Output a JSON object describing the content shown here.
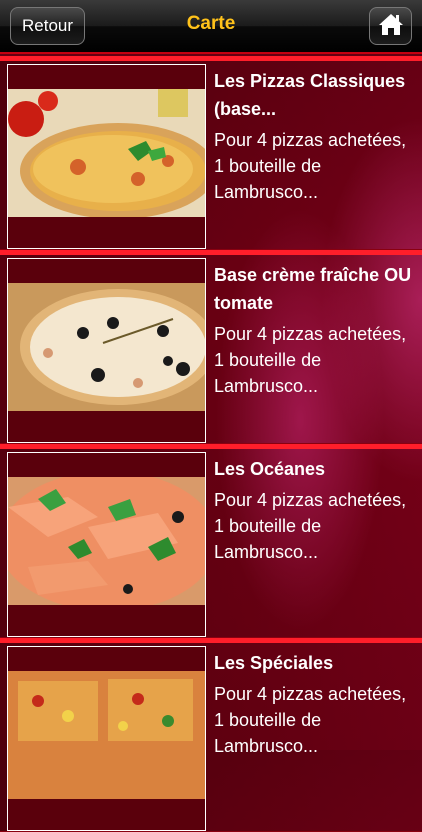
{
  "navbar": {
    "back_label": "Retour",
    "title": "Carte",
    "home_icon": "home-icon"
  },
  "items": [
    {
      "title": "Les Pizzas Classiques (base...",
      "desc": "Pour 4 pizzas achetées, 1 bouteille de Lambrusco..."
    },
    {
      "title": "Base crème fraîche OU tomate",
      "desc": "Pour 4 pizzas achetées, 1 bouteille de Lambrusco..."
    },
    {
      "title": "Les Océanes",
      "desc": "Pour 4 pizzas achetées, 1 bouteille de Lambrusco..."
    },
    {
      "title": "Les Spéciales",
      "desc": "Pour 4 pizzas achetées, 1 bouteille de Lambrusco..."
    }
  ],
  "colors": {
    "title": "#ffc21a",
    "separator": "#ff1e2a",
    "background": "#6a0012"
  }
}
